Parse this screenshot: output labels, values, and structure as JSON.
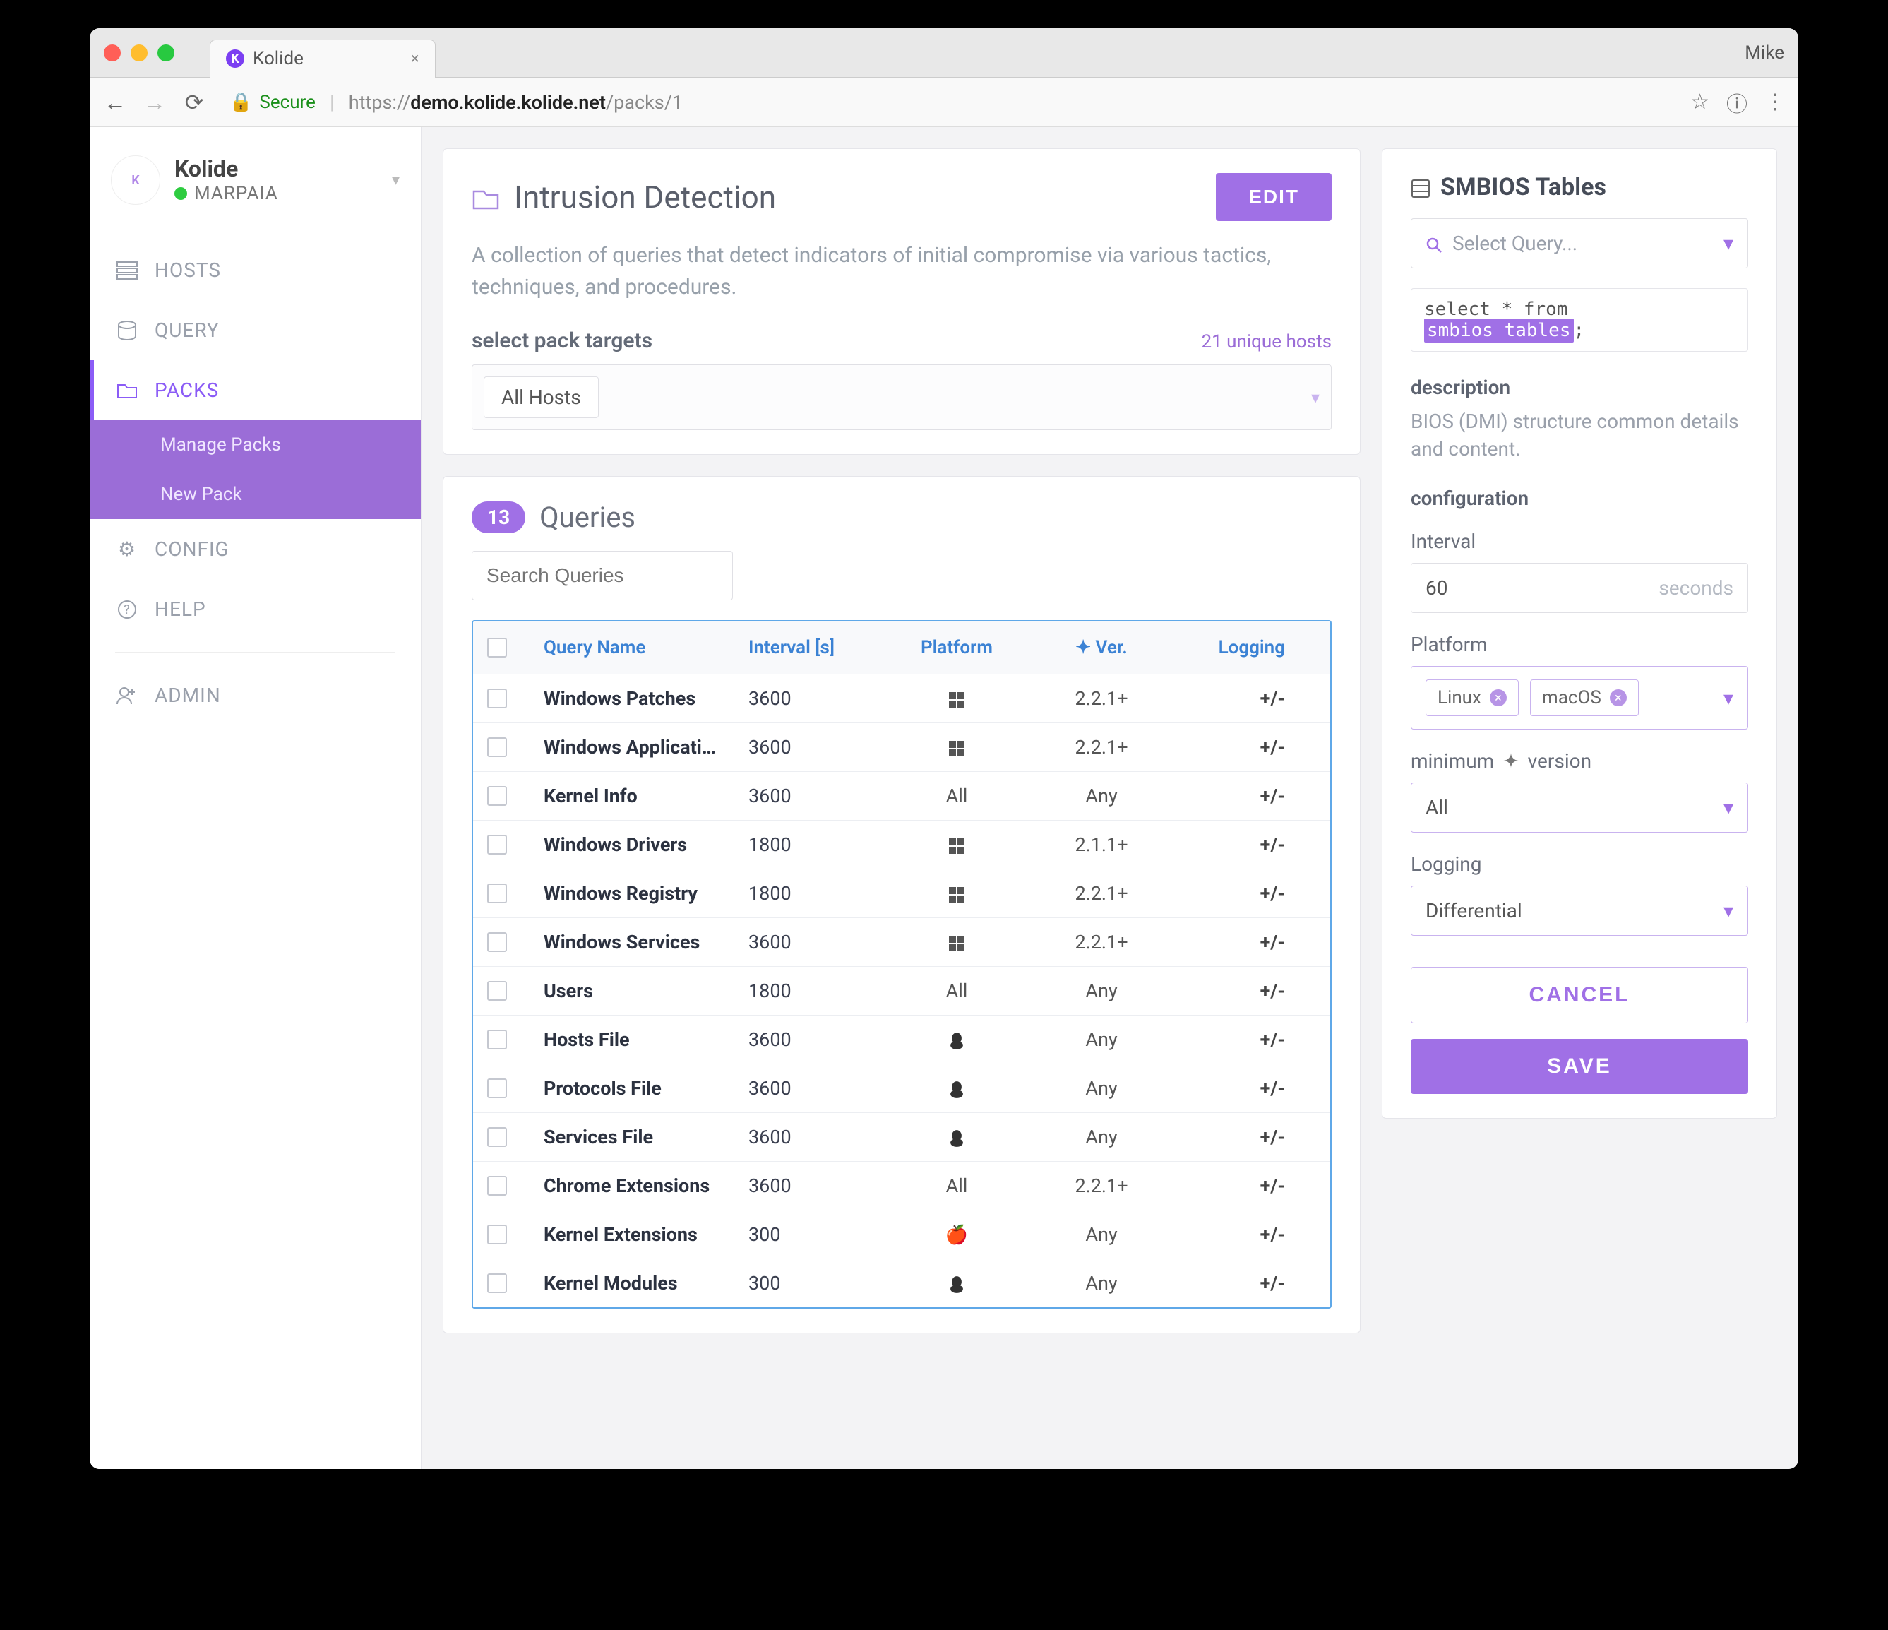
{
  "browser": {
    "tab_title": "Kolide",
    "profile": "Mike",
    "secure_label": "Secure",
    "url_prefix": "https://",
    "url_host": "demo.kolide.kolide.net",
    "url_path": "/packs/1"
  },
  "brand": {
    "name": "Kolide",
    "org": "MARPAIA"
  },
  "nav": {
    "hosts": "HOSTS",
    "query": "QUERY",
    "packs": "PACKS",
    "manage_packs": "Manage Packs",
    "new_pack": "New Pack",
    "config": "CONFIG",
    "help": "HELP",
    "admin": "ADMIN"
  },
  "pack": {
    "title": "Intrusion Detection",
    "edit": "EDIT",
    "description": "A collection of queries that detect indicators of initial compromise via various tactics, techniques, and procedures.",
    "targets_label": "select pack targets",
    "targets_count": "21 unique hosts",
    "targets_chip": "All Hosts"
  },
  "queries": {
    "count": "13",
    "title": "Queries",
    "search_placeholder": "Search Queries",
    "head": {
      "name": "Query Name",
      "interval": "Interval [s]",
      "platform": "Platform",
      "ver": "Ver.",
      "logging": "Logging"
    },
    "rows": [
      {
        "name": "Windows Patches",
        "interval": "3600",
        "platform": "win",
        "ver": "2.2.1+",
        "log": "+/-"
      },
      {
        "name": "Windows Applicati…",
        "interval": "3600",
        "platform": "win",
        "ver": "2.2.1+",
        "log": "+/-"
      },
      {
        "name": "Kernel Info",
        "interval": "3600",
        "platform": "All",
        "ver": "Any",
        "log": "+/-"
      },
      {
        "name": "Windows Drivers",
        "interval": "1800",
        "platform": "win",
        "ver": "2.1.1+",
        "log": "+/-"
      },
      {
        "name": "Windows Registry",
        "interval": "1800",
        "platform": "win",
        "ver": "2.2.1+",
        "log": "+/-"
      },
      {
        "name": "Windows Services",
        "interval": "3600",
        "platform": "win",
        "ver": "2.2.1+",
        "log": "+/-"
      },
      {
        "name": "Users",
        "interval": "1800",
        "platform": "All",
        "ver": "Any",
        "log": "+/-"
      },
      {
        "name": "Hosts File",
        "interval": "3600",
        "platform": "linux",
        "ver": "Any",
        "log": "+/-"
      },
      {
        "name": "Protocols File",
        "interval": "3600",
        "platform": "linux",
        "ver": "Any",
        "log": "+/-"
      },
      {
        "name": "Services File",
        "interval": "3600",
        "platform": "linux",
        "ver": "Any",
        "log": "+/-"
      },
      {
        "name": "Chrome Extensions",
        "interval": "3600",
        "platform": "All",
        "ver": "2.2.1+",
        "log": "+/-"
      },
      {
        "name": "Kernel Extensions",
        "interval": "300",
        "platform": "mac",
        "ver": "Any",
        "log": "+/-"
      },
      {
        "name": "Kernel Modules",
        "interval": "300",
        "platform": "linux",
        "ver": "Any",
        "log": "+/-"
      }
    ]
  },
  "right": {
    "title": "SMBIOS Tables",
    "select_placeholder": "Select Query...",
    "code_prefix": "select * from ",
    "code_table": "smbios_tables",
    "code_suffix": ";",
    "desc_label": "description",
    "desc_text": "BIOS (DMI) structure common details and content.",
    "config_label": "configuration",
    "interval_label": "Interval",
    "interval_value": "60",
    "interval_suffix": "seconds",
    "platform_label": "Platform",
    "platform_chips": [
      "Linux",
      "macOS"
    ],
    "min_label_prefix": "minimum",
    "min_label_suffix": "version",
    "min_value": "All",
    "logging_label": "Logging",
    "logging_value": "Differential",
    "cancel": "CANCEL",
    "save": "SAVE"
  }
}
